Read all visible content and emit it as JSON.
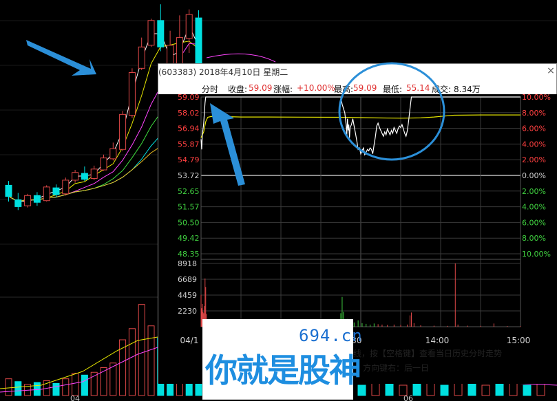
{
  "background_chart": {
    "candles": [
      {
        "o": 52.3,
        "c": 51.0,
        "h": 52.8,
        "l": 50.4,
        "up": false
      },
      {
        "o": 50.6,
        "c": 49.8,
        "h": 51.4,
        "l": 49.4,
        "up": false
      },
      {
        "o": 49.9,
        "c": 51.1,
        "h": 51.3,
        "l": 49.7,
        "up": true
      },
      {
        "o": 51.1,
        "c": 50.3,
        "h": 51.5,
        "l": 49.9,
        "up": false
      },
      {
        "o": 50.5,
        "c": 52.1,
        "h": 52.3,
        "l": 50.4,
        "up": true
      },
      {
        "o": 52.0,
        "c": 51.2,
        "h": 52.4,
        "l": 50.9,
        "up": false
      },
      {
        "o": 51.3,
        "c": 52.9,
        "h": 53.2,
        "l": 51.1,
        "up": true
      },
      {
        "o": 52.9,
        "c": 53.8,
        "h": 54.1,
        "l": 52.6,
        "up": true
      },
      {
        "o": 53.7,
        "c": 53.0,
        "h": 54.5,
        "l": 52.8,
        "up": false
      },
      {
        "o": 53.1,
        "c": 54.2,
        "h": 54.6,
        "l": 52.9,
        "up": true
      },
      {
        "o": 54.1,
        "c": 55.5,
        "h": 55.9,
        "l": 54.0,
        "up": true
      },
      {
        "o": 55.4,
        "c": 56.6,
        "h": 57.3,
        "l": 55.2,
        "up": true
      },
      {
        "o": 56.5,
        "c": 60.6,
        "h": 61.0,
        "l": 56.3,
        "up": true
      },
      {
        "o": 60.5,
        "c": 65.5,
        "h": 66.0,
        "l": 60.2,
        "up": true
      },
      {
        "o": 66.0,
        "c": 68.5,
        "h": 69.6,
        "l": 65.8,
        "up": true
      },
      {
        "o": 68.7,
        "c": 71.6,
        "h": 71.8,
        "l": 68.5,
        "up": true
      },
      {
        "o": 71.6,
        "c": 68.5,
        "h": 73.5,
        "l": 68.0,
        "up": false
      },
      {
        "o": 68.7,
        "c": 66.3,
        "h": 70.4,
        "l": 62.0,
        "up": true
      },
      {
        "o": 66.0,
        "c": 69.6,
        "h": 72.2,
        "l": 65.8,
        "up": true
      },
      {
        "o": 69.5,
        "c": 72.3,
        "h": 72.9,
        "l": 67.8,
        "up": true
      },
      {
        "o": 71.9,
        "c": 64.9,
        "h": 72.8,
        "l": 63.5,
        "up": false
      }
    ],
    "volume_bars": [
      {
        "v": 0.18,
        "up": true
      },
      {
        "v": 0.15,
        "up": false
      },
      {
        "v": 0.12,
        "up": true
      },
      {
        "v": 0.14,
        "up": false
      },
      {
        "v": 0.16,
        "up": true
      },
      {
        "v": 0.13,
        "up": false
      },
      {
        "v": 0.18,
        "up": true
      },
      {
        "v": 0.24,
        "up": true
      },
      {
        "v": 0.22,
        "up": false
      },
      {
        "v": 0.25,
        "up": true
      },
      {
        "v": 0.3,
        "up": true
      },
      {
        "v": 0.35,
        "up": true
      },
      {
        "v": 0.6,
        "up": true
      },
      {
        "v": 0.72,
        "up": true
      },
      {
        "v": 0.98,
        "up": true
      },
      {
        "v": 0.75,
        "up": true
      },
      {
        "v": 0.62,
        "up": false
      },
      {
        "v": 0.66,
        "up": false
      },
      {
        "v": 0.8,
        "up": true
      },
      {
        "v": 0.7,
        "up": false
      },
      {
        "v": 0.55,
        "up": false
      }
    ],
    "bottom_date_labels": [
      "04",
      "06"
    ]
  },
  "popup": {
    "title": "(603383) 2018年4月10日 星期二",
    "close_label": "×",
    "info": {
      "tab_label": "分时",
      "close_label": "收盘:",
      "close_value": "59.09",
      "change_label": "涨幅:",
      "change_value": "+10.00%",
      "high_label": "最高:",
      "high_value": "59.09",
      "low_label": "最低:",
      "low_value": "55.14",
      "volume_label": "成交:",
      "volume_value": "8.34万"
    },
    "price_axis": [
      "59.09",
      "58.02",
      "56.94",
      "55.87",
      "54.79",
      "53.72",
      "52.65",
      "51.57",
      "50.50",
      "49.42",
      "48.35"
    ],
    "pct_axis": [
      "10.00%",
      "8.00%",
      "6.00%",
      "4.00%",
      "2.00%",
      "0.00%",
      "2.00%",
      "4.00%",
      "6.00%",
      "8.00%",
      "10.00%"
    ],
    "volume_axis": [
      "8918",
      "6689",
      "4459",
      "2230"
    ],
    "time_axis": [
      "04/1",
      "1:30",
      "14:00",
      "15:00"
    ],
    "hint_line1": "线，按【空格键】查看当日历史分时走势",
    "hint_line2": "方向键右：后一日",
    "chart_data": {
      "type": "line",
      "title": "",
      "prev_close": 53.72,
      "ylim": [
        48.35,
        59.09
      ],
      "price_series": [
        [
          0,
          56.2
        ],
        [
          1,
          55.5
        ],
        [
          2,
          56.6
        ],
        [
          3,
          56.9
        ],
        [
          4,
          57.3
        ],
        [
          5,
          58.0
        ],
        [
          6,
          58.7
        ],
        [
          7,
          59.09
        ],
        [
          8,
          59.09
        ],
        [
          10,
          59.09
        ],
        [
          20,
          59.09
        ],
        [
          40,
          59.09
        ],
        [
          60,
          59.09
        ],
        [
          80,
          59.09
        ],
        [
          100,
          59.09
        ],
        [
          120,
          59.09
        ],
        [
          140,
          59.09
        ],
        [
          160,
          59.09
        ],
        [
          180,
          59.09
        ],
        [
          200,
          59.09
        ],
        [
          210,
          59.09
        ],
        [
          212,
          58.6
        ],
        [
          214,
          58.3
        ],
        [
          216,
          58.0
        ],
        [
          218,
          57.2
        ],
        [
          219,
          56.5
        ],
        [
          220,
          57.6
        ],
        [
          221,
          56.8
        ],
        [
          222,
          57.2
        ],
        [
          223,
          56.3
        ],
        [
          224,
          57.0
        ],
        [
          226,
          57.2
        ],
        [
          228,
          57.6
        ],
        [
          230,
          57.1
        ],
        [
          232,
          56.6
        ],
        [
          234,
          56.1
        ],
        [
          236,
          55.5
        ],
        [
          238,
          55.6
        ],
        [
          240,
          55.2
        ],
        [
          242,
          55.4
        ],
        [
          244,
          55.6
        ],
        [
          246,
          55.14
        ],
        [
          248,
          55.3
        ],
        [
          250,
          55.5
        ],
        [
          252,
          55.4
        ],
        [
          254,
          55.6
        ],
        [
          256,
          55.5
        ],
        [
          258,
          55.2
        ],
        [
          260,
          55.8
        ],
        [
          262,
          56.4
        ],
        [
          264,
          57.1
        ],
        [
          266,
          57.3
        ],
        [
          268,
          57.0
        ],
        [
          270,
          56.8
        ],
        [
          272,
          56.6
        ],
        [
          274,
          56.4
        ],
        [
          276,
          56.7
        ],
        [
          278,
          56.5
        ],
        [
          280,
          56.9
        ],
        [
          282,
          56.7
        ],
        [
          284,
          56.5
        ],
        [
          286,
          56.8
        ],
        [
          288,
          56.6
        ],
        [
          290,
          57.0
        ],
        [
          292,
          56.8
        ],
        [
          294,
          56.6
        ],
        [
          296,
          56.9
        ],
        [
          298,
          57.1
        ],
        [
          300,
          57.0
        ],
        [
          302,
          57.2
        ],
        [
          304,
          56.9
        ],
        [
          306,
          56.6
        ],
        [
          308,
          56.4
        ],
        [
          310,
          56.8
        ],
        [
          312,
          57.5
        ],
        [
          314,
          58.3
        ],
        [
          316,
          59.09
        ],
        [
          320,
          59.09
        ],
        [
          330,
          59.09
        ],
        [
          340,
          59.09
        ],
        [
          360,
          59.09
        ],
        [
          380,
          59.09
        ],
        [
          400,
          59.09
        ],
        [
          420,
          59.09
        ],
        [
          440,
          59.09
        ],
        [
          460,
          59.09
        ],
        [
          480,
          59.09
        ]
      ],
      "avg_series": [
        [
          0,
          56.3
        ],
        [
          4,
          56.7
        ],
        [
          7,
          57.4
        ],
        [
          10,
          57.7
        ],
        [
          15,
          57.75
        ],
        [
          30,
          57.75
        ],
        [
          60,
          57.72
        ],
        [
          100,
          57.72
        ],
        [
          150,
          57.71
        ],
        [
          210,
          57.7
        ],
        [
          260,
          57.66
        ],
        [
          300,
          57.64
        ],
        [
          330,
          57.66
        ],
        [
          350,
          57.72
        ],
        [
          380,
          57.84
        ],
        [
          420,
          57.86
        ],
        [
          480,
          57.86
        ]
      ],
      "volume_series": [
        [
          0,
          4500
        ],
        [
          1,
          2600
        ],
        [
          2,
          3200
        ],
        [
          3,
          2100
        ],
        [
          4,
          1900
        ],
        [
          5,
          2900
        ],
        [
          6,
          6800
        ],
        [
          7,
          5600
        ],
        [
          8,
          1800
        ],
        [
          9,
          900
        ],
        [
          12,
          700
        ],
        [
          15,
          500
        ],
        [
          20,
          450
        ],
        [
          25,
          700
        ],
        [
          30,
          500
        ],
        [
          35,
          400
        ],
        [
          40,
          350
        ],
        [
          50,
          300
        ],
        [
          60,
          400
        ],
        [
          70,
          300
        ],
        [
          90,
          250
        ],
        [
          110,
          300
        ],
        [
          130,
          250
        ],
        [
          150,
          300
        ],
        [
          170,
          250
        ],
        [
          190,
          200
        ],
        [
          205,
          300
        ],
        [
          210,
          1900
        ],
        [
          212,
          4200
        ],
        [
          214,
          2100
        ],
        [
          216,
          800
        ],
        [
          220,
          1100
        ],
        [
          224,
          700
        ],
        [
          230,
          600
        ],
        [
          236,
          900
        ],
        [
          242,
          500
        ],
        [
          248,
          400
        ],
        [
          254,
          300
        ],
        [
          260,
          450
        ],
        [
          266,
          350
        ],
        [
          272,
          300
        ],
        [
          280,
          250
        ],
        [
          290,
          300
        ],
        [
          300,
          250
        ],
        [
          310,
          300
        ],
        [
          314,
          1600
        ],
        [
          316,
          2000
        ],
        [
          320,
          500
        ],
        [
          330,
          200
        ],
        [
          350,
          150
        ],
        [
          370,
          120
        ],
        [
          382,
          8918
        ],
        [
          386,
          300
        ],
        [
          400,
          150
        ],
        [
          420,
          120
        ],
        [
          440,
          450
        ],
        [
          460,
          100
        ],
        [
          480,
          80
        ]
      ],
      "volume_ylim": [
        0,
        8918
      ]
    }
  },
  "annotations": {
    "highlight_circle_color": "#2b8fd8",
    "arrow_color": "#2b8fd8"
  },
  "watermark": {
    "domain": "694.cn",
    "slogan": "你就是股神"
  },
  "colors": {
    "up": "#e04848",
    "down": "#00e0e0",
    "price_line": "#ffffff",
    "avg_line": "#e8e800",
    "grid": "#3a3a3a",
    "axis_up_text": "#ff4040",
    "axis_down_text": "#40d040",
    "axis_neutral": "#d0d0d0"
  }
}
